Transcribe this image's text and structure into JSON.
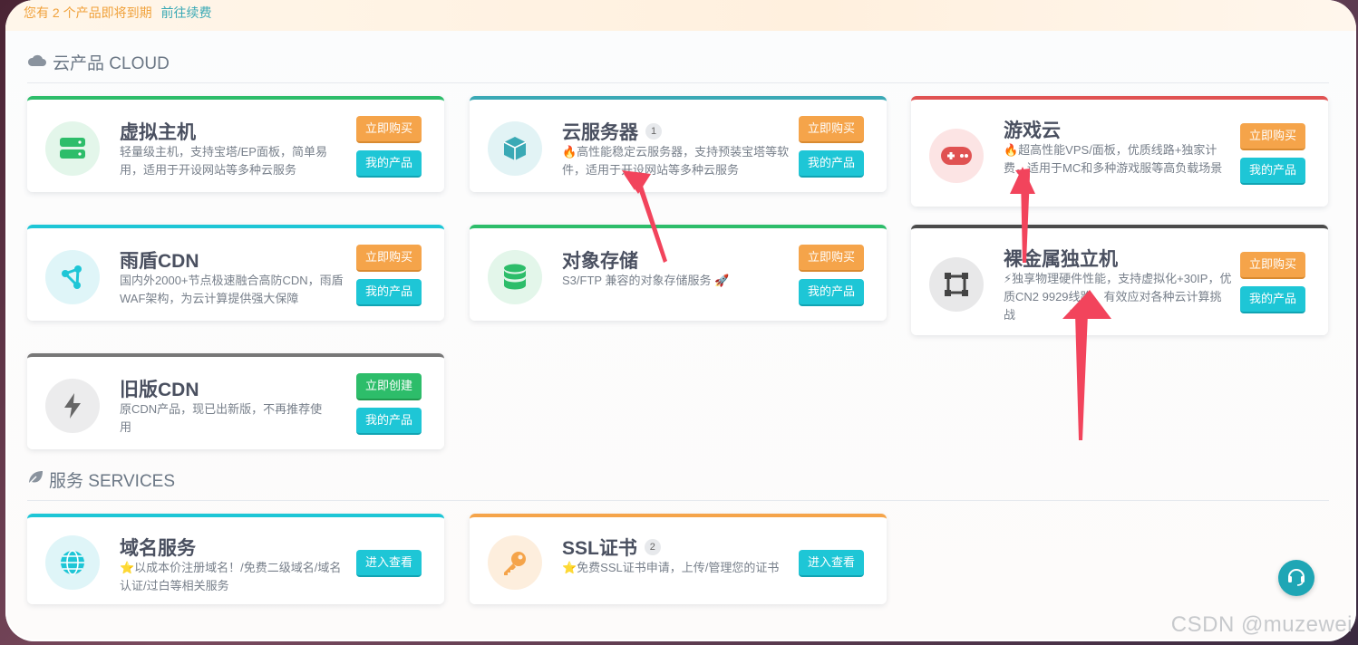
{
  "notice": {
    "text": "您有 2 个产品即将到期",
    "link": "前往续费"
  },
  "sections": {
    "cloud": "云产品 CLOUD",
    "services": "服务 SERVICES"
  },
  "cards": {
    "vhost": {
      "title": "虚拟主机",
      "desc": "轻量级主机，支持宝塔/EP面板，简单易用，适用于开设网站等多种云服务",
      "buy": "立即购买",
      "mine": "我的产品",
      "accent": "#2dbd6a"
    },
    "cvm": {
      "title": "云服务器",
      "badge": "1",
      "desc": "🔥高性能稳定云服务器，支持预装宝塔等软件，适用于开设网站等多种云服务",
      "buy": "立即购买",
      "mine": "我的产品",
      "accent": "#3aa9b5"
    },
    "game": {
      "title": "游戏云",
      "desc": "🔥超高性能VPS/面板，优质线路+独家计费，适用于MC和多种游戏服等高负载场景",
      "buy": "立即购买",
      "mine": "我的产品",
      "accent": "#e05252"
    },
    "cdn": {
      "title": "雨盾CDN",
      "desc": "国内外2000+节点极速融合高防CDN，雨盾WAF架构，为云计算提供强大保障",
      "buy": "立即购买",
      "mine": "我的产品",
      "accent": "#1ec6d6"
    },
    "oss": {
      "title": "对象存储",
      "desc": "S3/FTP 兼容的对象存储服务 🚀",
      "buy": "立即购买",
      "mine": "我的产品",
      "accent": "#2dbd6a"
    },
    "metal": {
      "title": "裸金属独立机",
      "desc": "⚡独享物理硬件性能，支持虚拟化+30IP，优质CN2 9929线路，有效应对各种云计算挑战",
      "buy": "立即购买",
      "mine": "我的产品",
      "accent": "#4a4a4a"
    },
    "oldcdn": {
      "title": "旧版CDN",
      "desc": "原CDN产品，现已出新版，不再推荐使用",
      "create": "立即创建",
      "mine": "我的产品",
      "accent": "#777777"
    },
    "domain": {
      "title": "域名服务",
      "desc": "⭐以成本价注册域名！/免费二级域名/域名认证/过白等相关服务",
      "view": "进入查看",
      "accent": "#1ec6d6"
    },
    "ssl": {
      "title": "SSL证书",
      "badge": "2",
      "desc": "⭐免费SSL证书申请，上传/管理您的证书",
      "view": "进入查看",
      "accent": "#f5a44a"
    }
  },
  "watermark": "CSDN @muzewei",
  "icons": [
    "cloud-icon",
    "leaf-icon",
    "server-icon",
    "cube-icon",
    "gamepad-icon",
    "share-node-icon",
    "database-icon",
    "chip-frame-icon",
    "bolt-icon",
    "globe-icon",
    "key-icon",
    "headset-icon",
    "arrow-annotation"
  ]
}
